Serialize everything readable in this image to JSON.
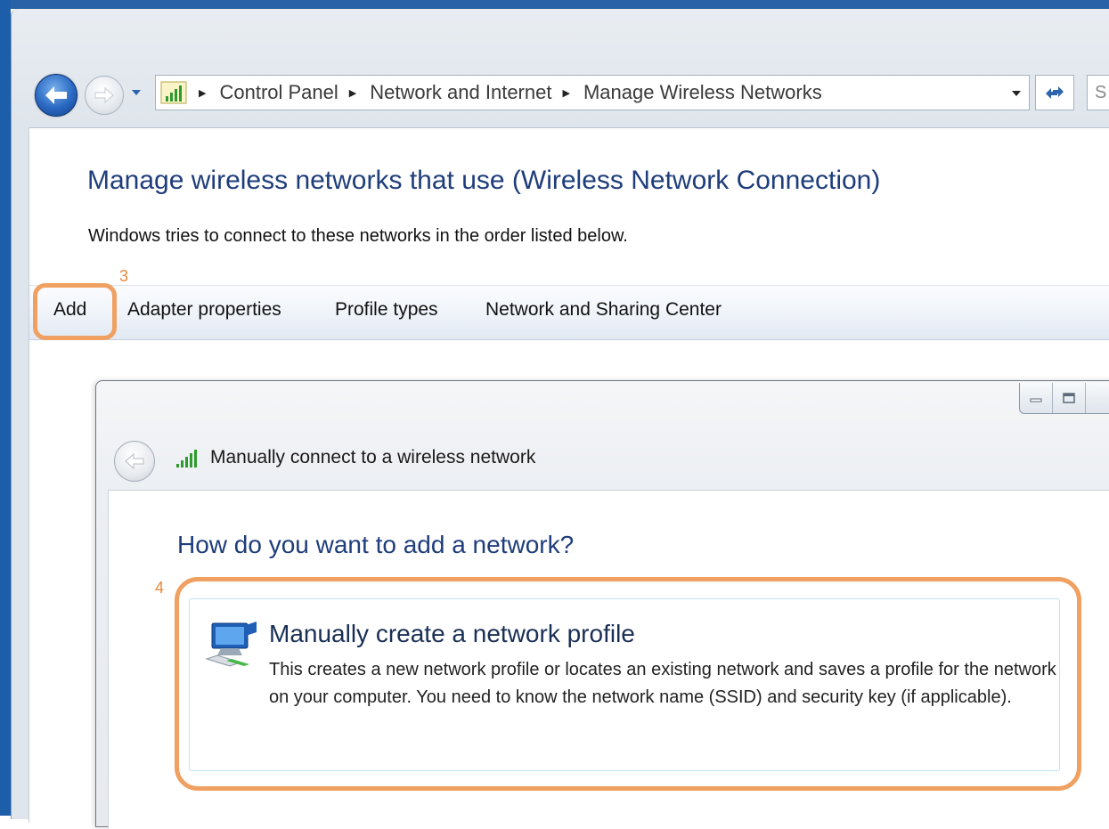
{
  "address_bar": {
    "breadcrumbs": [
      "Control Panel",
      "Network and Internet",
      "Manage Wireless Networks"
    ],
    "search_partial": "S"
  },
  "page": {
    "title": "Manage wireless networks that use (Wireless Network Connection)",
    "description": "Windows tries to connect to these networks in the order listed below."
  },
  "toolbar": {
    "add_label": "Add",
    "adapter_label": "Adapter properties",
    "profile_types_label": "Profile types",
    "sharing_center_label": "Network and Sharing Center"
  },
  "annotations": {
    "step3": "3",
    "step4": "4",
    "highlight_color": "#f0a060"
  },
  "dialog": {
    "title": "Manually connect to a wireless network",
    "heading": "How do you want to add a network?",
    "option": {
      "title": "Manually create a network profile",
      "description": "This creates a new network profile or locates an existing network and saves a profile for the network on your computer. You need to know the network name (SSID) and security key (if applicable)."
    }
  },
  "icons": [
    "back-arrow-icon",
    "forward-arrow-icon",
    "dropdown-icon",
    "network-signal-icon",
    "refresh-icon",
    "minimize-icon",
    "maximize-icon",
    "wireless-network-icon"
  ],
  "colors": {
    "title_blue": "#1e3d7a",
    "accent_orange": "#f0a060"
  }
}
